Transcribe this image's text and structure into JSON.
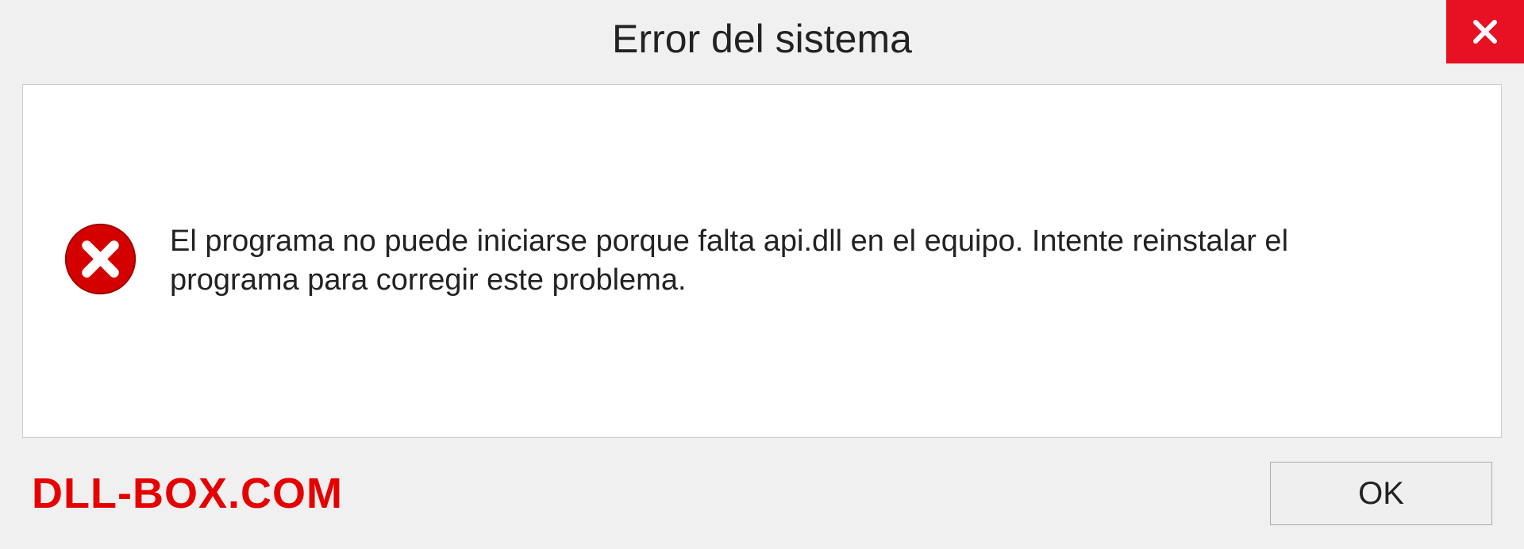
{
  "dialog": {
    "title": "Error del sistema",
    "message": "El programa no puede iniciarse porque falta api.dll en el equipo. Intente reinstalar el programa para corregir este problema.",
    "ok_label": "OK"
  },
  "watermark": "DLL-BOX.COM",
  "colors": {
    "close_bg": "#e81123",
    "error_red": "#d40000",
    "watermark_red": "#e60000"
  }
}
